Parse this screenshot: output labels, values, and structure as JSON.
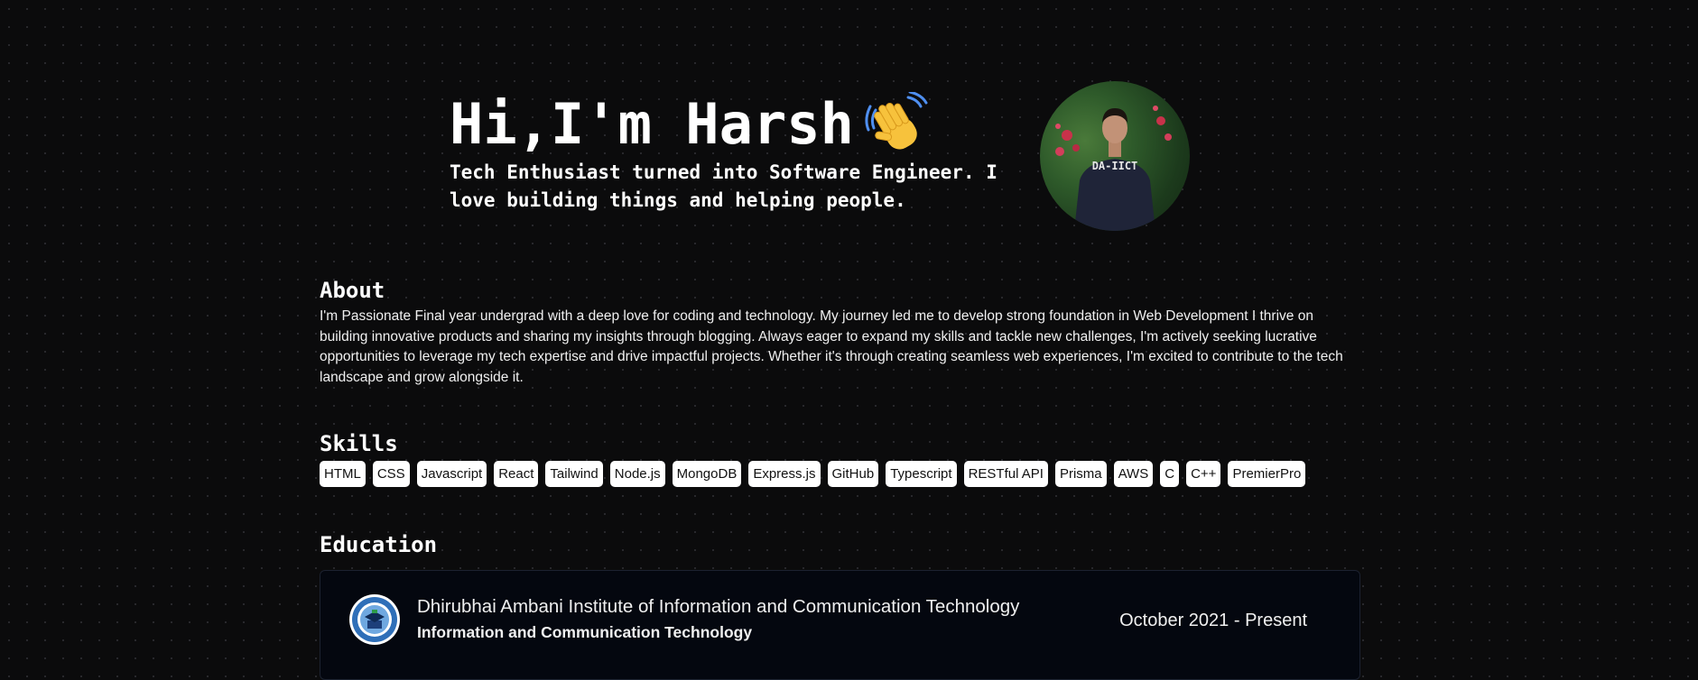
{
  "hero": {
    "greeting": "Hi,I'm Harsh",
    "wave_icon": "waving-hand-icon",
    "subtitle": "Tech Enthusiast turned into Software Engineer. I love building things and helping people."
  },
  "about": {
    "title": "About",
    "text": "I'm Passionate Final year undergrad with a deep love for coding and technology. My journey led me to develop strong foundation in Web Development I thrive on building innovative products and sharing my insights through blogging. Always eager to expand my skills and tackle new challenges, I'm actively seeking lucrative opportunities to leverage my tech expertise and drive impactful projects. Whether it's through creating seamless web experiences, I'm excited to contribute to the tech landscape and grow alongside it."
  },
  "skills": {
    "title": "Skills",
    "items": [
      "HTML",
      "CSS",
      "Javascript",
      "React",
      "Tailwind",
      "Node.js",
      "MongoDB",
      "Express.js",
      "GitHub",
      "Typescript",
      "RESTful API",
      "Prisma",
      "AWS",
      "C",
      "C++",
      "PremierPro"
    ]
  },
  "education": {
    "title": "Education",
    "items": [
      {
        "institution": "Dhirubhai Ambani Institute of Information and Communication Technology",
        "degree": "Information and Communication Technology",
        "dates": "October 2021 - Present"
      }
    ]
  },
  "colors": {
    "background": "#0b0b0c",
    "card": "#04070f",
    "text": "#ffffff",
    "chip_bg": "#ffffff"
  }
}
